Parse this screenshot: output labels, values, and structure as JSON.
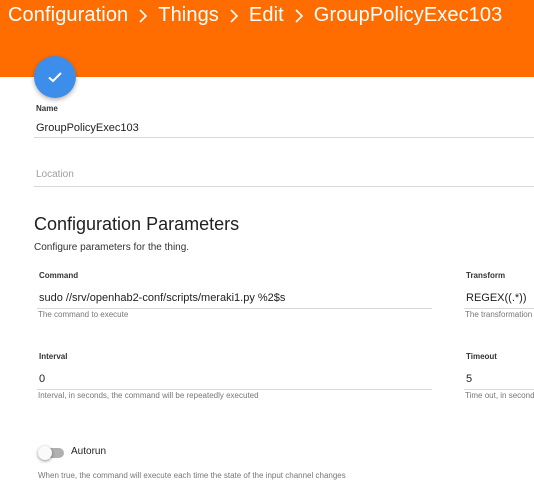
{
  "header": {
    "breadcrumb": [
      "Configuration",
      "Things",
      "Edit",
      "GroupPolicyExec103"
    ],
    "color": "#ff6d00"
  },
  "save_button": {
    "icon": "check-icon",
    "color": "#3d8eea"
  },
  "fields": {
    "name": {
      "label": "Name",
      "value": "GroupPolicyExec103"
    },
    "location": {
      "label": "Location",
      "value": ""
    }
  },
  "config": {
    "title": "Configuration Parameters",
    "subtitle": "Configure parameters for the thing.",
    "command": {
      "label": "Command",
      "value": "sudo //srv/openhab2-conf/scripts/meraki1.py %2$s",
      "help": "The command to execute"
    },
    "transform": {
      "label": "Transform",
      "value": "REGEX((.*))",
      "help": "The transformation"
    },
    "interval": {
      "label": "Interval",
      "value": "0",
      "help": "Interval, in seconds, the command will be repeatedly executed"
    },
    "timeout": {
      "label": "Timeout",
      "value": "5",
      "help": "Time out, in seconds"
    },
    "autorun": {
      "label": "Autorun",
      "enabled": false,
      "help": "When true, the command will execute each time the state of the input channel changes"
    }
  }
}
